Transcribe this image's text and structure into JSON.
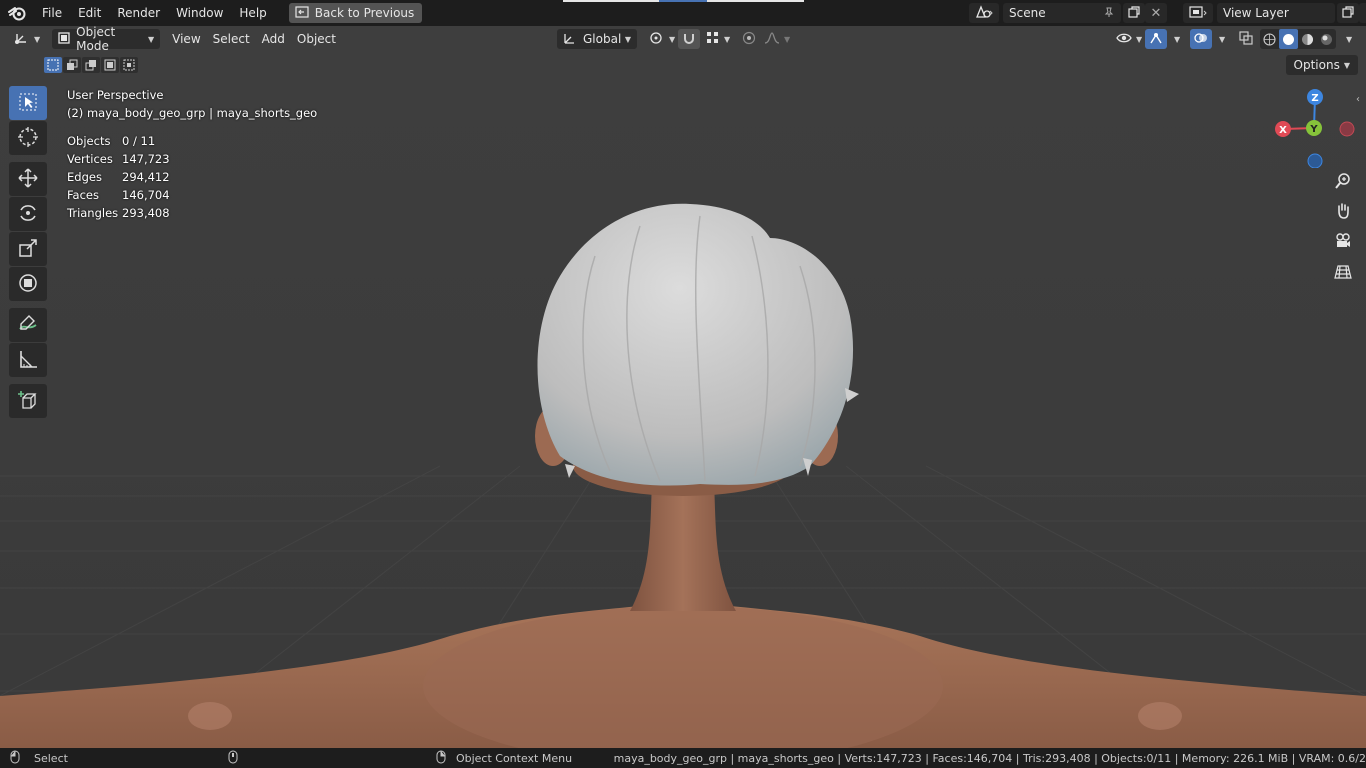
{
  "topbar": {
    "menu": [
      "File",
      "Edit",
      "Render",
      "Window",
      "Help"
    ],
    "back_button": "Back to Previous",
    "scene_name": "Scene",
    "view_layer": "View Layer"
  },
  "viewport_header": {
    "editor_type_icon": "transform-gizmo-icon",
    "mode": "Object Mode",
    "menus": [
      "View",
      "Select",
      "Add",
      "Object"
    ],
    "orientation": "Global",
    "options_label": "Options"
  },
  "overlay": {
    "view_name": "User Perspective",
    "object_path": "(2) maya_body_geo_grp | maya_shorts_geo",
    "stats": [
      {
        "label": "Objects",
        "value": "0 / 11"
      },
      {
        "label": "Vertices",
        "value": "147,723"
      },
      {
        "label": "Edges",
        "value": "294,412"
      },
      {
        "label": "Faces",
        "value": "146,704"
      },
      {
        "label": "Triangles",
        "value": "293,408"
      }
    ]
  },
  "gizmo": {
    "x": "X",
    "y": "Y",
    "z": "Z"
  },
  "statusbar": {
    "select": "Select",
    "context_menu": "Object Context Menu",
    "info": "maya_body_geo_grp | maya_shorts_geo | Verts:147,723 | Faces:146,704 | Tris:293,408 | Objects:0/11 | Memory: 226.1 MiB | VRAM: 0.6/2"
  },
  "colors": {
    "accent": "#4772b3",
    "axis_x": "#e04a55",
    "axis_y": "#86c33a",
    "axis_z": "#3d86e0",
    "skin": "#a87559",
    "hair": "#c9c9c9"
  }
}
